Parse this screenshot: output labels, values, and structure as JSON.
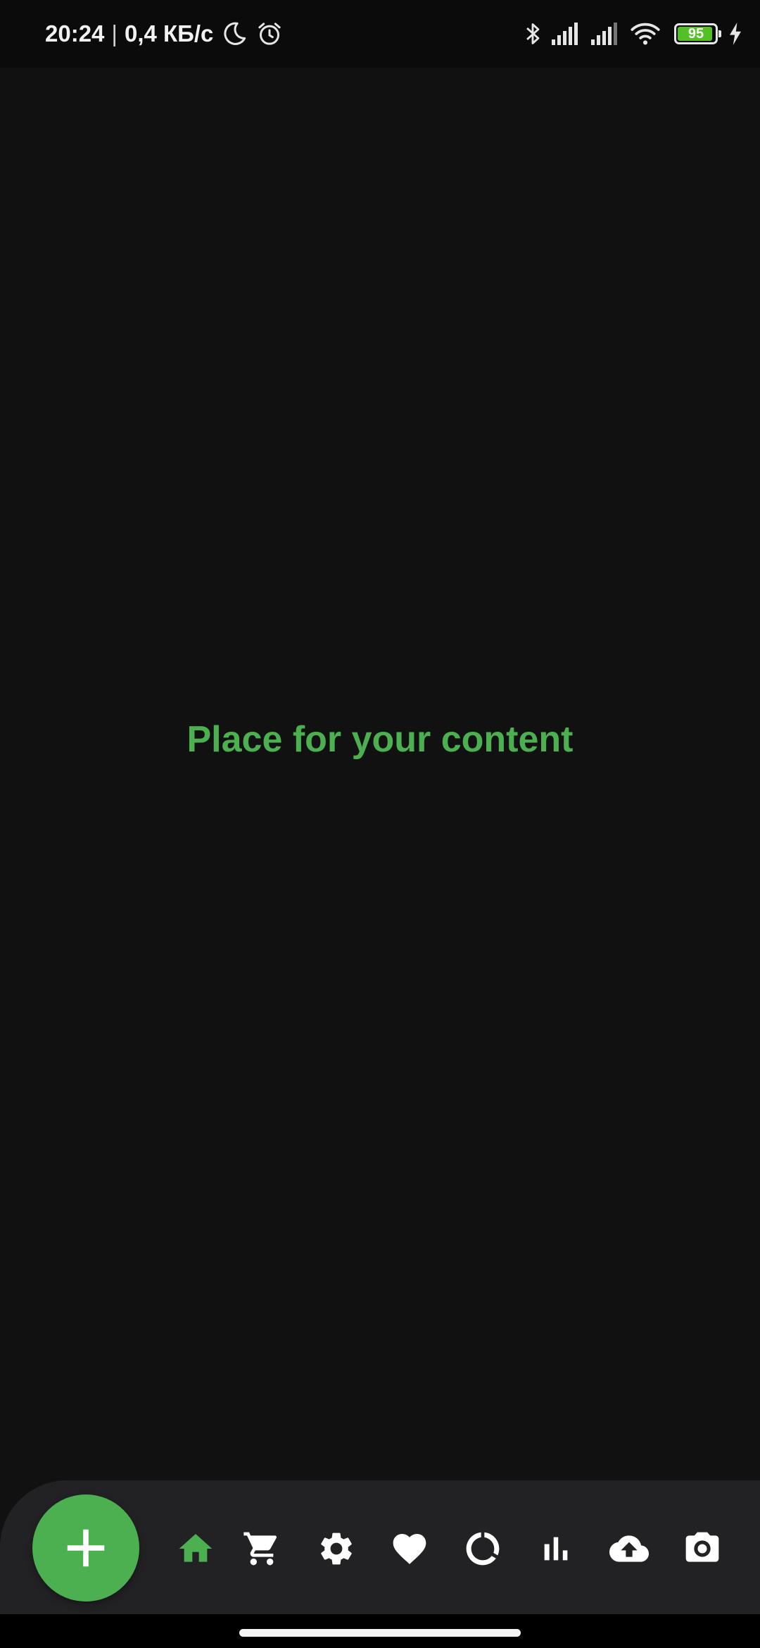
{
  "status_bar": {
    "time": "20:24",
    "separator": "|",
    "network_speed": "0,4 КБ/с",
    "battery_level": "95",
    "battery_fraction": 0.95,
    "battery_color": "#53c126",
    "icons": [
      "moon-icon",
      "alarm-icon",
      "bluetooth-icon",
      "signal-icon",
      "signal-icon",
      "wifi-icon",
      "battery-icon",
      "charging-icon"
    ]
  },
  "content": {
    "text": "Place for your content",
    "color": "#4caf50"
  },
  "bottom_nav": {
    "accent_color": "#4caf50",
    "background_color": "#222224",
    "fab": {
      "icon": "plus-icon"
    },
    "items": [
      {
        "id": "home",
        "icon": "home-icon",
        "active": true
      },
      {
        "id": "cart",
        "icon": "cart-icon",
        "active": false
      },
      {
        "id": "settings",
        "icon": "gear-icon",
        "active": false
      },
      {
        "id": "favorites",
        "icon": "heart-icon",
        "active": false
      },
      {
        "id": "loading",
        "icon": "circle-progress-icon",
        "active": false
      },
      {
        "id": "stats",
        "icon": "bar-chart-icon",
        "active": false
      },
      {
        "id": "upload",
        "icon": "cloud-upload-icon",
        "active": false
      },
      {
        "id": "camera",
        "icon": "camera-icon",
        "active": false
      }
    ]
  }
}
